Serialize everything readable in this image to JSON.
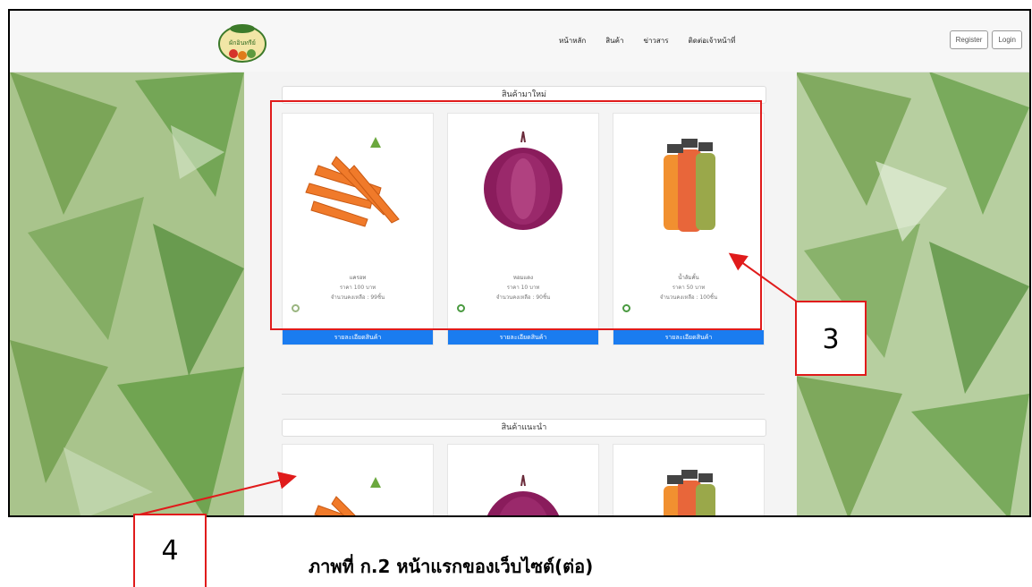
{
  "nav": {
    "links": [
      "หน้าหลัก",
      "สินค้า",
      "ข่าวสาร",
      "ติดต่อเจ้าหน้าที่"
    ],
    "register": "Register",
    "login": "Login",
    "logo_text": "ผักอินทรีย์"
  },
  "sections": {
    "new_title": "สินค้ามาใหม่",
    "recommended_title": "สินค้าแนะนำ"
  },
  "products": [
    {
      "name": "แครอท",
      "price": "ราคา 100 บาท",
      "stock": "จำนวนคงเหลือ : 99ชิ้น",
      "button": "รายละเอียดสินค้า"
    },
    {
      "name": "หอมแดง",
      "price": "ราคา 10 บาท",
      "stock": "จำนวนคงเหลือ : 90ชิ้น",
      "button": "รายละเอียดสินค้า"
    },
    {
      "name": "น้ำส้มคั้น",
      "price": "ราคา 50 บาท",
      "stock": "จำนวนคงเหลือ : 100ชิ้น",
      "button": "รายละเอียดสินค้า"
    }
  ],
  "callouts": {
    "three": "3",
    "four": "4"
  },
  "caption": "ภาพที่ ก.2 หน้าแรกของเว็บไซต์(ต่อ)",
  "colors": {
    "button": "#1a7cf0",
    "highlight": "#e01b1b",
    "leaf": "#5e9a3e"
  }
}
